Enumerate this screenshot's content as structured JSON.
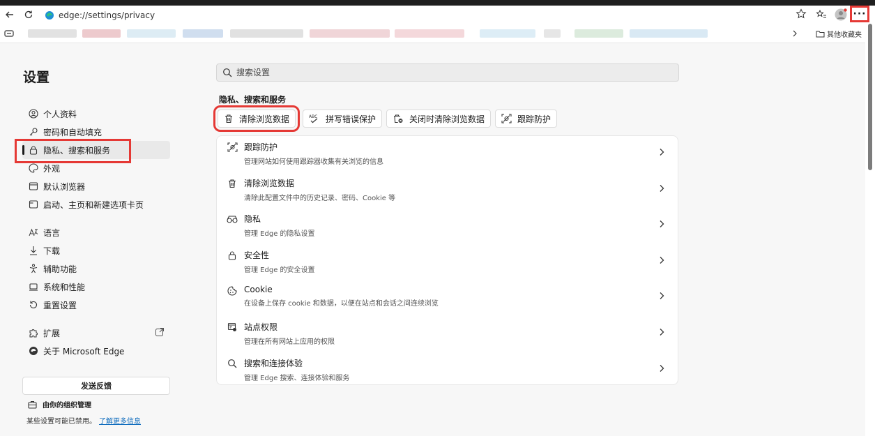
{
  "browser": {
    "url": "edge://settings/privacy",
    "favorites_other": "其他收藏夹"
  },
  "settings": {
    "title": "设置",
    "search_placeholder": "搜索设置",
    "sidebar": [
      {
        "id": "profile",
        "label": "个人资料",
        "icon": "person-icon"
      },
      {
        "id": "passwords",
        "label": "密码和自动填充",
        "icon": "key-icon"
      },
      {
        "id": "privacy",
        "label": "隐私、搜索和服务",
        "icon": "lock-icon",
        "active": true
      },
      {
        "id": "appearance",
        "label": "外观",
        "icon": "palette-icon"
      },
      {
        "id": "default-browser",
        "label": "默认浏览器",
        "icon": "browser-icon"
      },
      {
        "id": "start",
        "label": "启动、主页和新建选项卡页",
        "icon": "window-icon"
      },
      {
        "id": "language",
        "label": "语言",
        "icon": "language-icon"
      },
      {
        "id": "downloads",
        "label": "下载",
        "icon": "download-icon"
      },
      {
        "id": "accessibility",
        "label": "辅助功能",
        "icon": "accessibility-icon"
      },
      {
        "id": "system",
        "label": "系统和性能",
        "icon": "laptop-icon"
      },
      {
        "id": "reset",
        "label": "重置设置",
        "icon": "reset-icon"
      },
      {
        "id": "extensions",
        "label": "扩展",
        "icon": "puzzle-icon"
      },
      {
        "id": "about",
        "label": "关于 Microsoft Edge",
        "icon": "edge-icon"
      }
    ],
    "feedback": "发送反馈",
    "org_managed": "由你的组织管理",
    "org_note": "某些设置可能已禁用。",
    "org_link": "了解更多信息"
  },
  "main": {
    "section_title": "隐私、搜索和服务",
    "quick_actions": [
      {
        "label": "清除浏览数据",
        "icon": "trash-icon"
      },
      {
        "label": "拼写错误保护",
        "icon": "spellcheck-icon"
      },
      {
        "label": "关闭时清除浏览数据",
        "icon": "trash-x-icon"
      },
      {
        "label": "跟踪防护",
        "icon": "tracking-icon"
      }
    ],
    "rows": [
      {
        "title": "跟踪防护",
        "subtitle": "管理网站如何使用跟踪器收集有关浏览的信息",
        "icon": "tracking-icon"
      },
      {
        "title": "清除浏览数据",
        "subtitle": "清除此配置文件中的历史记录、密码、Cookie 等",
        "icon": "trash-icon"
      },
      {
        "title": "隐私",
        "subtitle": "管理 Edge 的隐私设置",
        "icon": "glasses-icon"
      },
      {
        "title": "安全性",
        "subtitle": "管理 Edge 的安全设置",
        "icon": "lock-icon"
      },
      {
        "title": "Cookie",
        "subtitle": "在设备上保存 cookie 和数据，以便在站点和会话之间连续浏览",
        "icon": "cookie-icon"
      },
      {
        "title": "站点权限",
        "subtitle": "管理在所有网站上应用的权限",
        "icon": "permissions-icon"
      },
      {
        "title": "搜索和连接体验",
        "subtitle": "管理 Edge 搜索、连接体验和服务",
        "icon": "search-icon"
      }
    ]
  }
}
